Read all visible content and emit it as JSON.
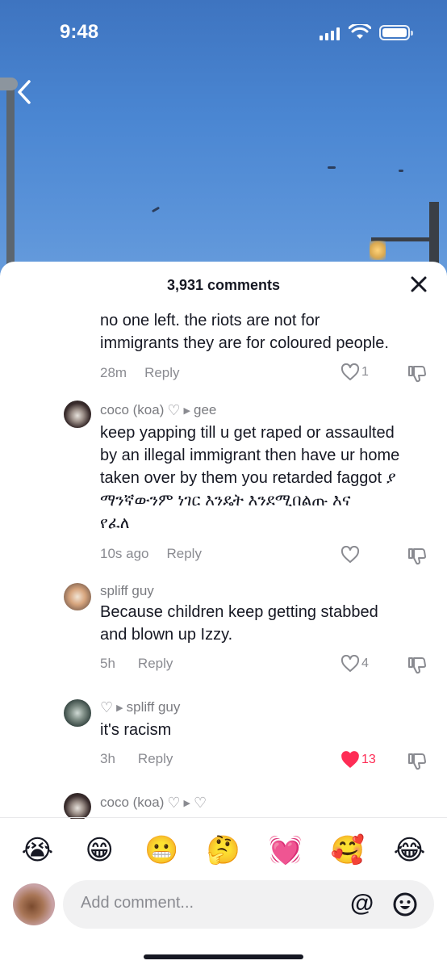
{
  "status_bar": {
    "time": "9:48"
  },
  "sheet": {
    "title": "3,931 comments"
  },
  "comments": [
    {
      "text_lines": [
        "no one left. the riots are not for",
        "immigrants they are for coloured people."
      ],
      "time": "28m",
      "reply_label": "Reply",
      "likes": "1",
      "liked": false
    },
    {
      "username": "coco (koa)",
      "reply_to": "gee",
      "text_lines": [
        "keep yapping till u get raped or assaulted",
        "by an illegal immigrant then have ur home",
        "taken over by them you retarded faggot ያ",
        "ማንኛውንም ነገር እንዴት እንደሚበልጡ እና",
        "የፈለ"
      ],
      "time": "10s ago",
      "reply_label": "Reply",
      "likes": "",
      "liked": false
    },
    {
      "username": "spliff guy",
      "text_lines": [
        "Because children keep getting stabbed",
        "and blown up Izzy."
      ],
      "time": "5h",
      "reply_label": "Reply",
      "likes": "4",
      "liked": false
    },
    {
      "username": "",
      "reply_to": "spliff guy",
      "text_lines": [
        "it's racism"
      ],
      "time": "3h",
      "reply_label": "Reply",
      "likes": "13",
      "liked": true
    },
    {
      "username": "coco (koa)",
      "reply_to": ""
    }
  ],
  "emoji_bar": [
    "😭",
    "😁",
    "😬",
    "🤔",
    "💓",
    "🥰",
    "😂"
  ],
  "composer": {
    "placeholder": "Add comment...",
    "at_symbol": "@"
  },
  "colors": {
    "accent_like": "#fe2c55",
    "text_primary": "#161823",
    "text_secondary": "#8a8b91"
  }
}
